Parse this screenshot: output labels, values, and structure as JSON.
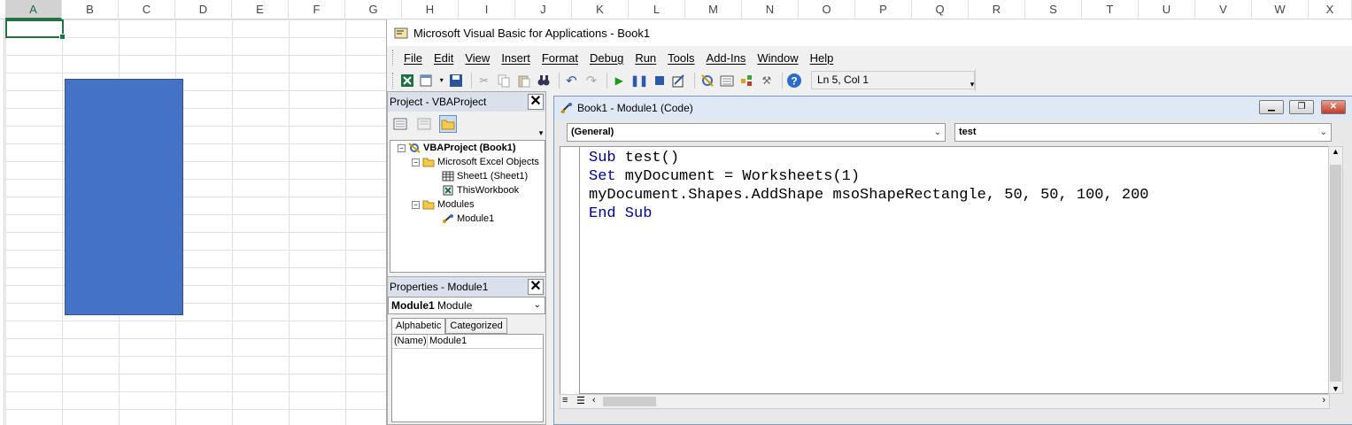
{
  "excel": {
    "columns": [
      "A",
      "B",
      "C",
      "D",
      "E",
      "F",
      "G",
      "H",
      "I",
      "J",
      "K",
      "L",
      "M",
      "N",
      "O",
      "P",
      "Q",
      "R",
      "S",
      "T",
      "U",
      "V",
      "W",
      "X"
    ],
    "selected_column": "A",
    "shape_color": "#4472c4"
  },
  "vbe": {
    "title": "Microsoft Visual Basic for Applications - Book1",
    "menu": [
      "File",
      "Edit",
      "View",
      "Insert",
      "Format",
      "Debug",
      "Run",
      "Tools",
      "Add-Ins",
      "Window",
      "Help"
    ],
    "status_position": "Ln 5, Col 1",
    "project": {
      "title": "Project - VBAProject",
      "close_glyph": "✕",
      "tree": [
        {
          "label": "VBAProject (Book1)",
          "bold": true
        },
        {
          "label": "Microsoft Excel Objects"
        },
        {
          "label": "Sheet1 (Sheet1)"
        },
        {
          "label": "ThisWorkbook"
        },
        {
          "label": "Modules"
        },
        {
          "label": "Module1"
        }
      ]
    },
    "properties": {
      "title": "Properties - Module1",
      "object_name": "Module1",
      "object_type": "Module",
      "tabs": [
        "Alphabetic",
        "Categorized"
      ],
      "rows": [
        {
          "key": "(Name)",
          "value": "Module1"
        }
      ]
    },
    "code_window": {
      "title": "Book1 - Module1 (Code)",
      "object_combo": "(General)",
      "proc_combo": "test",
      "lines": [
        {
          "kw": "Sub",
          "rest": " test()"
        },
        {
          "kw": "Set",
          "rest": " myDocument = Worksheets(1)"
        },
        {
          "kw": "",
          "rest": "myDocument.Shapes.AddShape msoShapeRectangle, 50, 50, 100, 200"
        },
        {
          "kw": "End Sub",
          "rest": ""
        }
      ]
    }
  }
}
